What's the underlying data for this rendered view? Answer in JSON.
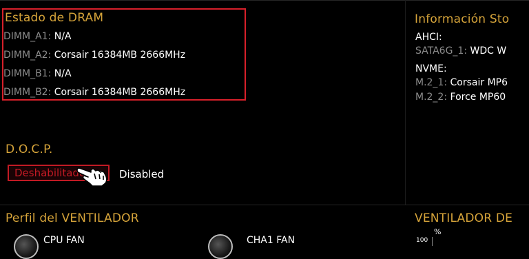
{
  "dram": {
    "title": "Estado de DRAM",
    "slots": [
      {
        "label": "DIMM_A1:",
        "value": "N/A"
      },
      {
        "label": "DIMM_A2:",
        "value": "Corsair 16384MB 2666MHz"
      },
      {
        "label": "DIMM_B1:",
        "value": "N/A"
      },
      {
        "label": "DIMM_B2:",
        "value": "Corsair 16384MB 2666MHz"
      }
    ]
  },
  "storage": {
    "title": "Información Sto",
    "ahci_label": "AHCI:",
    "sata_label": "SATA6G_1:",
    "sata_value": "WDC W",
    "nvme_label": "NVME:",
    "m2_1_label": "M.2_1:",
    "m2_1_value": "Corsair MP6",
    "m2_2_label": "M.2_2:",
    "m2_2_value": "Force MP60"
  },
  "docp": {
    "title": "D.O.C.P.",
    "selected": "Deshabilitado",
    "status": "Disabled"
  },
  "fan_profile": {
    "title": "Perfil del VENTILADOR",
    "fans": [
      "CPU FAN",
      "CHA1 FAN"
    ]
  },
  "fan_curve": {
    "title": "VENTILADOR DE",
    "unit": "%",
    "tick_100": "100"
  },
  "colors": {
    "accent": "#d6a43a",
    "highlight": "#d8202a",
    "background": "#000000"
  }
}
